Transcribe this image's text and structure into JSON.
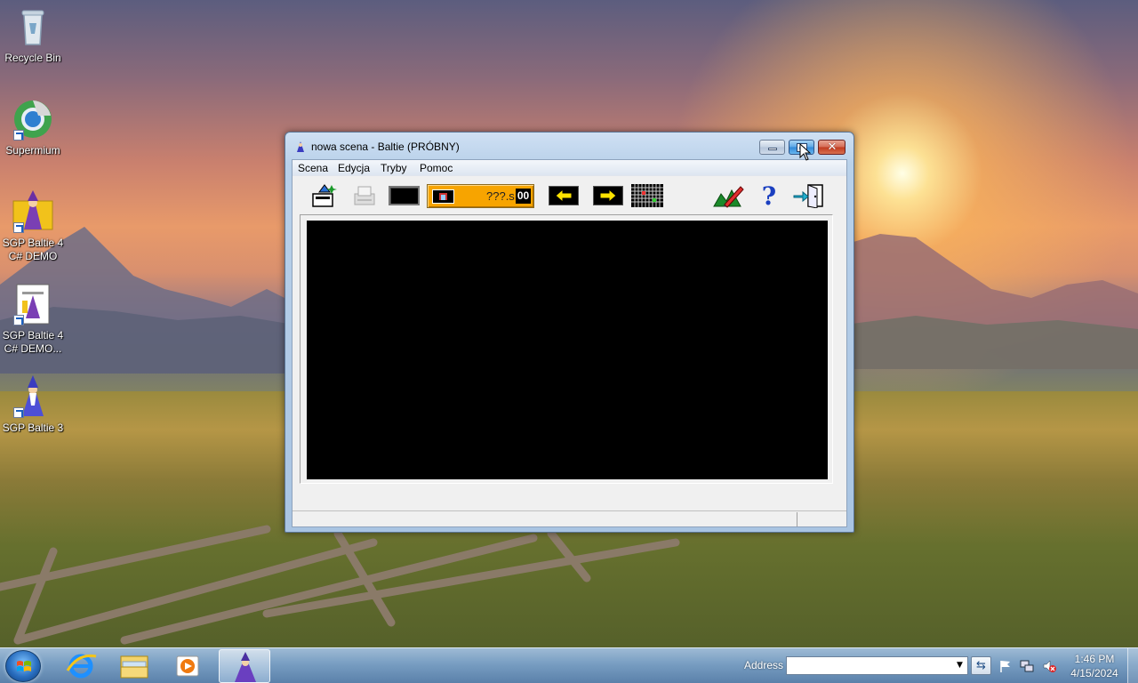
{
  "desktop": {
    "icons": [
      {
        "label": "Recycle Bin"
      },
      {
        "label": "Supermium"
      },
      {
        "label": "SGP Baltie 4 C# DEMO"
      },
      {
        "label": "SGP Baltie 4 C# DEMO..."
      },
      {
        "label": "SGP Baltie 3"
      }
    ]
  },
  "window": {
    "title": "nowa scena - Baltie (PRÓBNY)",
    "menu": [
      "Scena",
      "Edycja",
      "Tryby",
      "Pomoc"
    ],
    "toolbar": {
      "scene_name": "???.s",
      "scene_number": "00"
    },
    "icons": {
      "title": "baltie-wizard-icon",
      "new": "new-scene-icon",
      "print": "print-icon",
      "prev": "arrow-left-icon",
      "next": "arrow-right-icon",
      "grid": "grid-icon",
      "edit": "edit-pencil-icon",
      "help": "question-mark-icon",
      "exit": "exit-door-icon"
    }
  },
  "taskbar": {
    "address_label": "Address",
    "address_value": "",
    "clock_time": "1:46 PM",
    "clock_date": "4/15/2024"
  },
  "colors": {
    "scene_bar": "#f7a400",
    "stage": "#000000",
    "close_button": "#c0391e"
  }
}
